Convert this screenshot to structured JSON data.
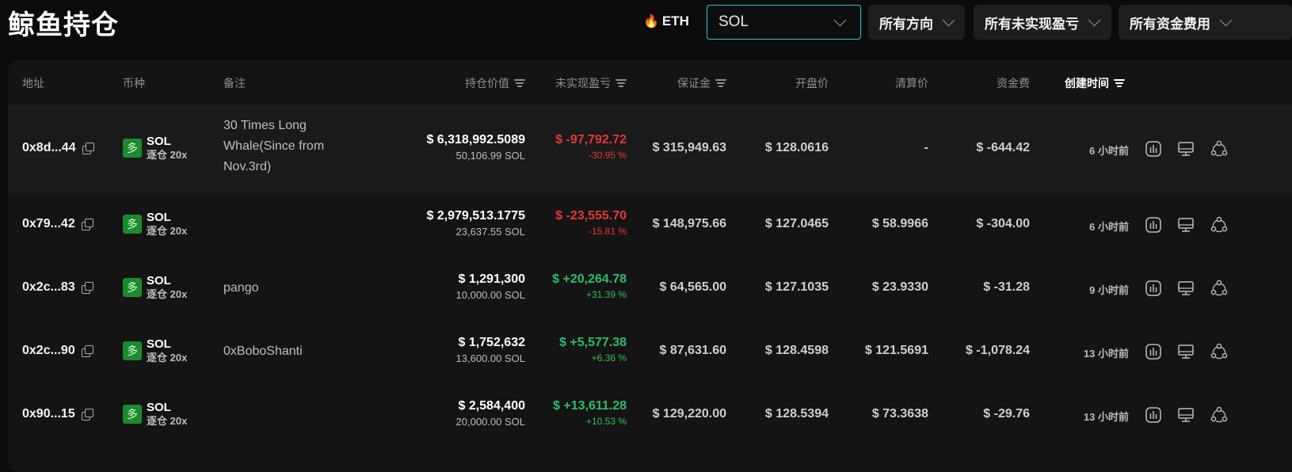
{
  "page_title": "鲸鱼持仓",
  "eth_tab": {
    "label": "ETH",
    "icon": "fire-icon"
  },
  "coin_select": {
    "value": "SOL"
  },
  "filters": {
    "direction": "所有方向",
    "unrealized_pnl": "所有未实现盈亏",
    "funding_fee": "所有资金费用"
  },
  "columns": {
    "address": "地址",
    "coin": "币种",
    "note": "备注",
    "position_value": "持仓价值",
    "unrealized_pnl": "未实现盈亏",
    "margin": "保证金",
    "open_price": "开盘价",
    "liq_price": "清算价",
    "funding_fee": "资金费",
    "created_time": "创建时间"
  },
  "colors": {
    "accent": "#2ec8d6",
    "positive": "#2ebd6a",
    "negative": "#e53935",
    "long_badge": "#1d8a2e"
  },
  "rows": [
    {
      "address": "0x8d...44",
      "side": "多",
      "coin": "SOL",
      "leverage": "逐仓 20x",
      "note": "30 Times Long Whale(Since from Nov.3rd)",
      "value": "$ 6,318,992.5089",
      "qty": "50,106.99 SOL",
      "pnl": "$ -97,792.72",
      "pnl_pct": "-30.95 %",
      "pnl_sign": "neg",
      "margin": "$ 315,949.63",
      "open": "$ 128.0616",
      "liq": "-",
      "funding": "$ -644.42",
      "time": "6 小时前"
    },
    {
      "address": "0x79...42",
      "side": "多",
      "coin": "SOL",
      "leverage": "逐仓 20x",
      "note": "",
      "value": "$ 2,979,513.1775",
      "qty": "23,637.55 SOL",
      "pnl": "$ -23,555.70",
      "pnl_pct": "-15.81 %",
      "pnl_sign": "neg",
      "margin": "$ 148,975.66",
      "open": "$ 127.0465",
      "liq": "$ 58.9966",
      "funding": "$ -304.00",
      "time": "6 小时前"
    },
    {
      "address": "0x2c...83",
      "side": "多",
      "coin": "SOL",
      "leverage": "逐仓 20x",
      "note": "pango",
      "value": "$ 1,291,300",
      "qty": "10,000.00 SOL",
      "pnl": "$ +20,264.78",
      "pnl_pct": "+31.39 %",
      "pnl_sign": "pos",
      "margin": "$ 64,565.00",
      "open": "$ 127.1035",
      "liq": "$ 23.9330",
      "funding": "$ -31.28",
      "time": "9 小时前"
    },
    {
      "address": "0x2c...90",
      "side": "多",
      "coin": "SOL",
      "leverage": "逐仓 20x",
      "note": "0xBoboShanti",
      "value": "$ 1,752,632",
      "qty": "13,600.00 SOL",
      "pnl": "$ +5,577.38",
      "pnl_pct": "+6.36 %",
      "pnl_sign": "pos",
      "margin": "$ 87,631.60",
      "open": "$ 128.4598",
      "liq": "$ 121.5691",
      "funding": "$ -1,078.24",
      "time": "13 小时前"
    },
    {
      "address": "0x90...15",
      "side": "多",
      "coin": "SOL",
      "leverage": "逐仓 20x",
      "note": "",
      "value": "$ 2,584,400",
      "qty": "20,000.00 SOL",
      "pnl": "$ +13,611.28",
      "pnl_pct": "+10.53 %",
      "pnl_sign": "pos",
      "margin": "$ 129,220.00",
      "open": "$ 128.5394",
      "liq": "$ 73.3638",
      "funding": "$ -29.76",
      "time": "13 小时前"
    }
  ]
}
